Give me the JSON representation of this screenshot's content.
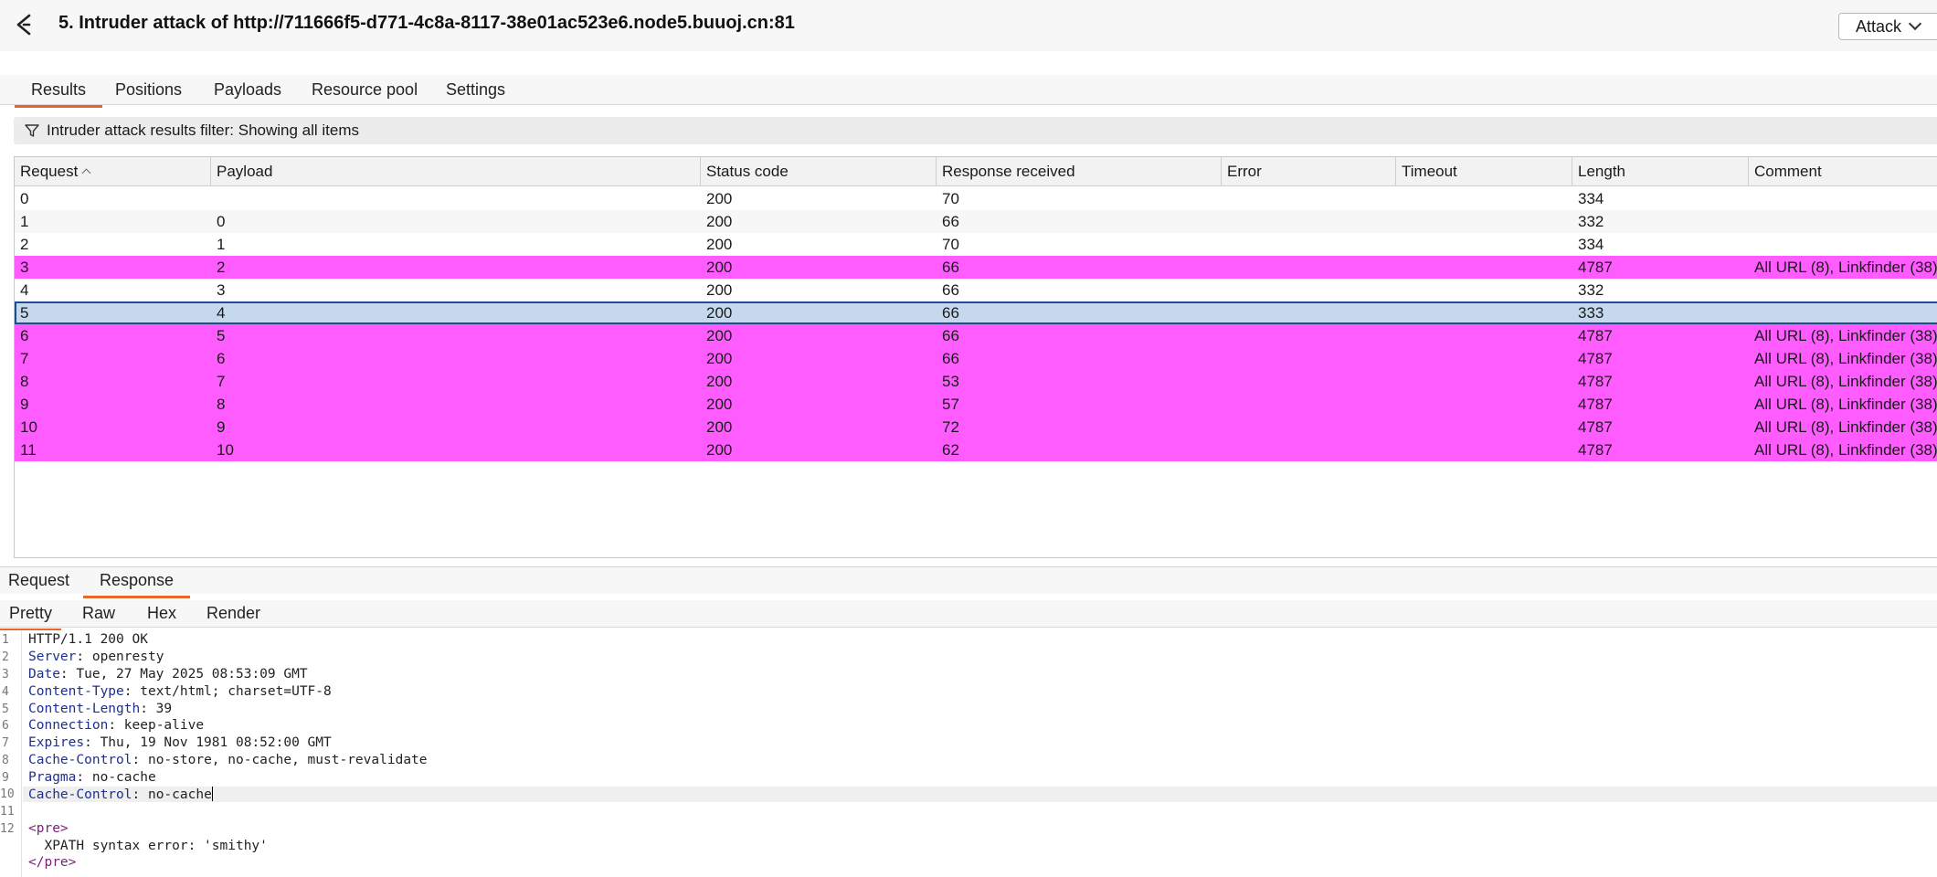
{
  "window": {
    "title": "5. Intruder attack of http://711666f5-d771-4c8a-8117-38e01ac523e6.node5.buuoj.cn:81",
    "attack_button": "Attack"
  },
  "tabs": [
    {
      "label": "Results",
      "active": true
    },
    {
      "label": "Positions"
    },
    {
      "label": "Payloads"
    },
    {
      "label": "Resource pool"
    },
    {
      "label": "Settings"
    }
  ],
  "filter": {
    "text": "Intruder attack results filter: Showing all items"
  },
  "table": {
    "columns": [
      "Request",
      "Payload",
      "Status code",
      "Response received",
      "Error",
      "Timeout",
      "Length",
      "Comment"
    ],
    "rows": [
      {
        "request": "0",
        "payload": "",
        "status": "200",
        "received": "70",
        "error": "",
        "timeout": "",
        "length": "334",
        "comment": "",
        "style": "plain"
      },
      {
        "request": "1",
        "payload": "0",
        "status": "200",
        "received": "66",
        "error": "",
        "timeout": "",
        "length": "332",
        "comment": "",
        "style": "alt"
      },
      {
        "request": "2",
        "payload": "1",
        "status": "200",
        "received": "70",
        "error": "",
        "timeout": "",
        "length": "334",
        "comment": "",
        "style": "plain"
      },
      {
        "request": "3",
        "payload": "2",
        "status": "200",
        "received": "66",
        "error": "",
        "timeout": "",
        "length": "4787",
        "comment": "All URL (8), Linkfinder (38)",
        "style": "hl"
      },
      {
        "request": "4",
        "payload": "3",
        "status": "200",
        "received": "66",
        "error": "",
        "timeout": "",
        "length": "332",
        "comment": "",
        "style": "plain"
      },
      {
        "request": "5",
        "payload": "4",
        "status": "200",
        "received": "66",
        "error": "",
        "timeout": "",
        "length": "333",
        "comment": "",
        "style": "sel"
      },
      {
        "request": "6",
        "payload": "5",
        "status": "200",
        "received": "66",
        "error": "",
        "timeout": "",
        "length": "4787",
        "comment": "All URL (8), Linkfinder (38)",
        "style": "hl"
      },
      {
        "request": "7",
        "payload": "6",
        "status": "200",
        "received": "66",
        "error": "",
        "timeout": "",
        "length": "4787",
        "comment": "All URL (8), Linkfinder (38)",
        "style": "hl"
      },
      {
        "request": "8",
        "payload": "7",
        "status": "200",
        "received": "53",
        "error": "",
        "timeout": "",
        "length": "4787",
        "comment": "All URL (8), Linkfinder (38)",
        "style": "hl"
      },
      {
        "request": "9",
        "payload": "8",
        "status": "200",
        "received": "57",
        "error": "",
        "timeout": "",
        "length": "4787",
        "comment": "All URL (8), Linkfinder (38)",
        "style": "hl"
      },
      {
        "request": "10",
        "payload": "9",
        "status": "200",
        "received": "72",
        "error": "",
        "timeout": "",
        "length": "4787",
        "comment": "All URL (8), Linkfinder (38)",
        "style": "hl"
      },
      {
        "request": "11",
        "payload": "10",
        "status": "200",
        "received": "62",
        "error": "",
        "timeout": "",
        "length": "4787",
        "comment": "All URL (8), Linkfinder (38)",
        "style": "hl"
      }
    ]
  },
  "message_tabs": [
    {
      "label": "Request"
    },
    {
      "label": "Response",
      "active": true
    }
  ],
  "view_tabs": [
    {
      "label": "Pretty",
      "active": true
    },
    {
      "label": "Raw"
    },
    {
      "label": "Hex"
    },
    {
      "label": "Render"
    }
  ],
  "response": {
    "line_numbers": [
      "1",
      "2",
      "3",
      "4",
      "5",
      "6",
      "7",
      "8",
      "9",
      "10",
      "11",
      "12"
    ],
    "status_line": "HTTP/1.1 200 OK",
    "headers": [
      {
        "key": "Server",
        "value": " openresty"
      },
      {
        "key": "Date",
        "value": " Tue, 27 May 2025 08:53:09 GMT"
      },
      {
        "key": "Content-Type",
        "value": " text/html; charset=UTF-8"
      },
      {
        "key": "Content-Length",
        "value": " 39"
      },
      {
        "key": "Connection",
        "value": " keep-alive"
      },
      {
        "key": "Expires",
        "value": " Thu, 19 Nov 1981 08:52:00 GMT"
      },
      {
        "key": "Cache-Control",
        "value": " no-store, no-cache, must-revalidate"
      },
      {
        "key": "Pragma",
        "value": " no-cache"
      },
      {
        "key": "Cache-Control",
        "value": " no-cache"
      }
    ],
    "body_open": "<pre>",
    "body_text": "  XPATH syntax error: 'smithy'",
    "body_close": "</pre>"
  },
  "colors": {
    "highlight_row": "#ff5cff",
    "selected_row": "#c6d8ee",
    "active_tab_underline": "#e8672a",
    "header_key": "#1e2f8f"
  },
  "icons": {
    "logo": "burp-intruder-icon",
    "filter": "filter-funnel-icon",
    "attack_dropdown": "chevron-down-icon",
    "sort": "sort-ascending-icon"
  }
}
